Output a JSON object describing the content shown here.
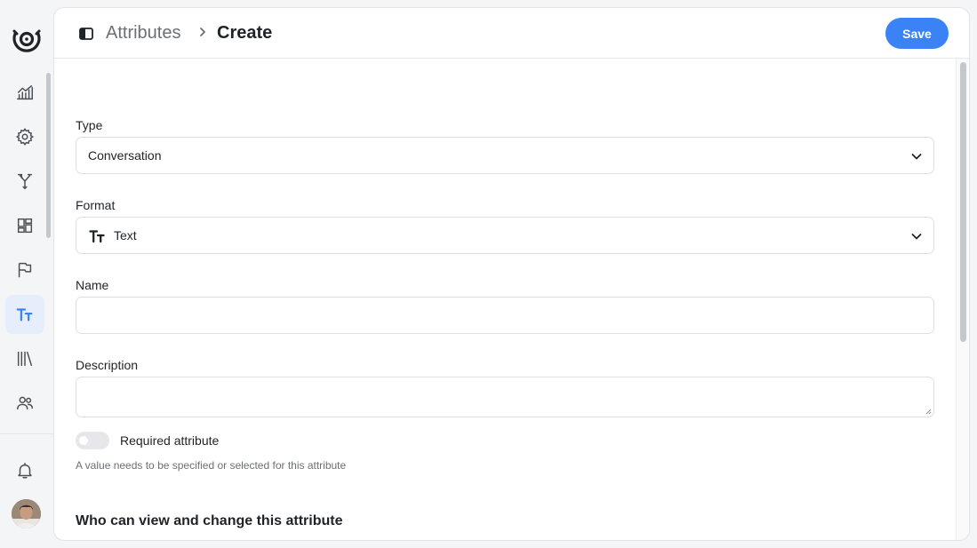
{
  "breadcrumb": {
    "parent": "Attributes",
    "current": "Create"
  },
  "header": {
    "save_label": "Save"
  },
  "form": {
    "type": {
      "label": "Type",
      "value": "Conversation"
    },
    "format": {
      "label": "Format",
      "value": "Text",
      "icon": "text-format-icon"
    },
    "name": {
      "label": "Name",
      "value": "",
      "placeholder": ""
    },
    "description": {
      "label": "Description",
      "value": "",
      "placeholder": ""
    },
    "required": {
      "label": "Required attribute",
      "hint": "A value needs to be specified or selected for this attribute",
      "enabled": false
    },
    "permissions_title": "Who can view and change this attribute"
  },
  "sidebar": {
    "items": [
      {
        "icon": "reports-icon"
      },
      {
        "icon": "settings-gear-icon"
      },
      {
        "icon": "workflows-branch-icon"
      },
      {
        "icon": "dashboard-widgets-icon"
      },
      {
        "icon": "flag-icon"
      },
      {
        "icon": "attributes-text-icon",
        "active": true
      },
      {
        "icon": "library-icon"
      },
      {
        "icon": "users-icon"
      }
    ],
    "bottom": [
      {
        "icon": "notifications-bell-icon"
      },
      {
        "icon": "user-avatar"
      }
    ]
  },
  "colors": {
    "accent": "#3b82f6",
    "active_bg": "#e6eefc"
  }
}
